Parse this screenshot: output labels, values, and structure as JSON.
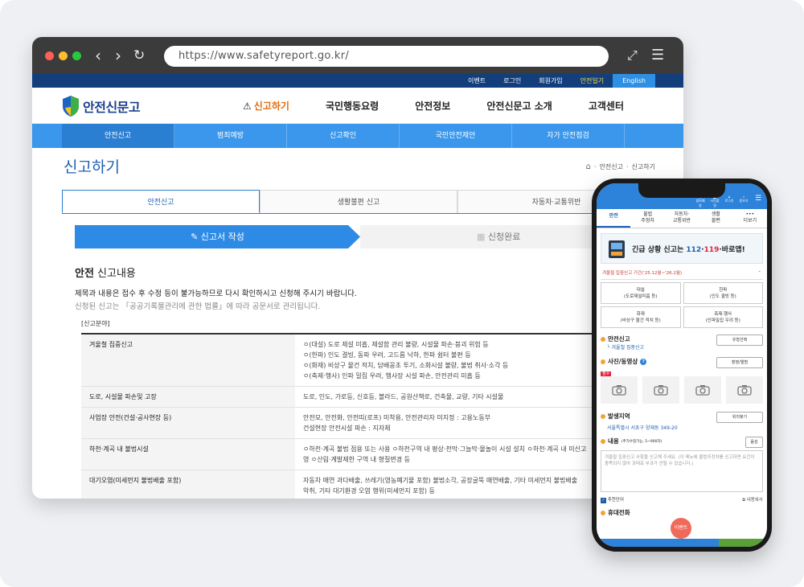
{
  "browser": {
    "url": "https://www.safetyreport.go.kr/",
    "colors": {
      "primary": "#2d8be6",
      "navy": "#123f7c",
      "accent_orange": "#e06c12"
    }
  },
  "util_links": [
    "이벤트",
    "로그인",
    "회원가입",
    "안전일기",
    "English"
  ],
  "logo_text": "안전신문고",
  "gnb": [
    "신고하기",
    "국민행동요령",
    "안전정보",
    "안전신문고 소개",
    "고객센터"
  ],
  "subnav": [
    "안전신고",
    "범죄예방",
    "신고확인",
    "국민안전제안",
    "자가 안전점검"
  ],
  "page_title": "신고하기",
  "breadcrumb": [
    "안전신고",
    "신고하기"
  ],
  "tabs": [
    "안전신고",
    "생활불편 신고",
    "자동차·교통위반"
  ],
  "steps": [
    "신고서 작성",
    "신청완료"
  ],
  "section": {
    "title_bold": "안전",
    "title_rest": " 신고내용",
    "desc1": "제목과 내용은 접수 후 수정 등이 불가능하므로 다시 확인하시고 신청해 주시기 바랍니다.",
    "desc2": "신청된 신고는 「공공기록물관리에 관한 법률」에 따라 공문서로 관리됩니다.",
    "field_label": "[신고분야]"
  },
  "table_rows": [
    {
      "head": "겨울철 집중신고",
      "lines": [
        "ㅇ(대설) 도로 제설 미흡, 제설함 관리 불량, 시설물 파손·붕괴 위험 등",
        "ㅇ(한파) 인도 결빙, 동파 우려, 고드름 낙하, 한파 쉼터 불편 등",
        "ㅇ(화재) 비상구 물건 적치, 담배꽁초 투기, 소화시설 불량, 불법 취사·소각 등",
        "ㅇ(축제·행사) 인파 밀집 우려, 행사장 시설 파손, 안전관리 미흡 등"
      ]
    },
    {
      "head": "도로, 시설물 파손및 고장",
      "lines": [
        "도로, 인도, 가로등, 신호등, 볼라드, 공원산책로, 건축물, 교량, 기타 시설물"
      ]
    },
    {
      "head": "사업장 안전(건설·공사현장 등)",
      "lines": [
        "안전모, 안전화, 안전띠(로프) 미착용, 안전관리자 미지정 : 고용노동부",
        "건설현장 안전시설 파손 : 지자체"
      ]
    },
    {
      "head": "하천·계곡 내 불법시설",
      "lines": [
        "ㅇ하천·계곡 불법 점용 또는 사용 ㅇ하천구역 내 평상·천막·그늘막·물놀이 시설 설치 ㅇ하천·계곡 내 미신고",
        "영 ㅇ산림·계발제한 구역 내 형질변경 등"
      ]
    },
    {
      "head": "대기오염(미세먼지 불법배출 포함)",
      "lines": [
        "자동차 매연 과다배출, 쓰레기(영농폐기물 포함) 불법소각, 공장굴뚝 매연배출, 기타 미세먼지 불법배출",
        "악취, 기타 대기환경 오염 행위(미세먼지 포함) 등"
      ]
    }
  ],
  "mobile": {
    "top_icons": [
      "범죄예방",
      "사진촬영",
      "로그인",
      "돋보기"
    ],
    "tabs": [
      "안전",
      "불법\n주정차",
      "자동차·\n교통위반",
      "생활\n불편",
      "•••\n더보기"
    ],
    "banner_pre": "긴급 상황 신고는 ",
    "banner_num1": "112",
    "banner_dot": "·",
    "banner_num2": "119",
    "banner_post": "·바로앱!",
    "period": "겨울철 집중신고 기간('25.12월~'26.2월)",
    "categories": [
      "대설\n(도로제설미흡 등)",
      "한파\n(인도 결빙 등)",
      "화재\n(비상구 물건 적치 등)",
      "축제·행사\n(인파밀집 우려 등)"
    ],
    "safety_label": "안전신고",
    "safety_value": "겨울철 집중신고",
    "type_button": "유형선택",
    "photo_label": "사진/동영상",
    "photo_button": "촬영/앨범",
    "required": "필수",
    "location_label": "발생지역",
    "location_value": "서울특별시 서초구 양재동 349-20",
    "location_button": "위치찾기",
    "content_label": "내용",
    "content_hint": "(추가수정가능, 5~900자)",
    "voice_button": "음성",
    "content_placeholder": "겨울철 집중신고 사항을 신고해 주세요. (이 메뉴에 불법주정차를 신고하면 요건이 충족되지 않아 과태료 부과가 안될 수 있습니다.)",
    "recommend_label": "추천단어",
    "copy_label": "내용복사",
    "phone_label": "휴대전화",
    "fab": "이벤트"
  }
}
